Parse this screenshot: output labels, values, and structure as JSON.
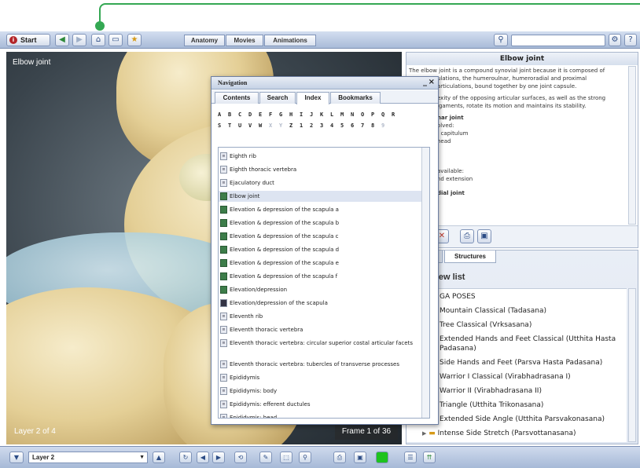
{
  "toolbar": {
    "start_label": "Start",
    "tabs": [
      "Anatomy",
      "Movies",
      "Animations"
    ],
    "search_value": ""
  },
  "viewer": {
    "title": "Elbow joint",
    "layer_label": "Layer 2 of 4",
    "frame_counter": "Frame 1 of 36"
  },
  "info_panel": {
    "title": "Elbow joint",
    "paragraphs": [
      "The elbow joint is a compound synovial joint because it is composed of",
      "ulations, the humeroulnar, humeroradial and proximal",
      "articulations, bound together by one joint capsule."
    ],
    "paragraph2": [
      "exity of the opposing articular surfaces, as well as the strong",
      "igaments, rotate its motion and maintains its stability."
    ],
    "section1": {
      "heading": "nar joint",
      "lines": [
        "olved:",
        ": capitulum",
        "head"
      ]
    },
    "section2": {
      "lines": [
        "available:",
        "nd extension"
      ]
    },
    "section3": {
      "heading": "dial joint"
    }
  },
  "lower_panel": {
    "sections_tab": "s",
    "structures_tab": "Structures",
    "list_title": "omy view list",
    "items": [
      "GA POSES",
      "Mountain Classical (Tadasana)",
      "Tree Classical (Vrksasana)",
      "Extended Hands and Feet Classical (Utthita Hasta",
      "Padasana)",
      "Side Hands and Feet (Parsva Hasta Padasana)",
      "Warrior I Classical (Virabhadrasana I)",
      "Warrior II (Virabhadrasana II)",
      "Triangle (Utthita Trikonasana)",
      "Extended Side Angle (Utthita Parsvakonasana)",
      "Intense Side Stretch (Parsvottanasana)"
    ]
  },
  "navigation": {
    "title": "Navigation",
    "min_label": "_",
    "close_label": "×",
    "tabs": [
      "Contents",
      "Search",
      "Index",
      "Bookmarks"
    ],
    "active_tab": "Index",
    "letters_row1": [
      "A",
      "B",
      "C",
      "D",
      "E",
      "F",
      "G",
      "H",
      "I",
      "J",
      "K",
      "L",
      "M",
      "N",
      "O",
      "P",
      "Q",
      "R"
    ],
    "letters_row2": [
      "S",
      "T",
      "U",
      "V",
      "W",
      "X",
      "Y",
      "Z",
      "1",
      "2",
      "3",
      "4",
      "5",
      "6",
      "7",
      "8",
      "9"
    ],
    "index_items": [
      {
        "label": "Eighth rib",
        "icon": "page-icon"
      },
      {
        "label": "Eighth thoracic vertebra",
        "icon": "page-icon"
      },
      {
        "label": "Ejaculatory duct",
        "icon": "page-icon"
      },
      {
        "label": "Elbow joint",
        "icon": "animation-icon",
        "selected": true
      },
      {
        "label": "Elevation & depression of the scapula a",
        "icon": "animation-icon"
      },
      {
        "label": "Elevation & depression of the scapula b",
        "icon": "animation-icon"
      },
      {
        "label": "Elevation & depression of the scapula c",
        "icon": "animation-icon"
      },
      {
        "label": "Elevation & depression of the scapula d",
        "icon": "animation-icon"
      },
      {
        "label": "Elevation & depression of the scapula e",
        "icon": "animation-icon"
      },
      {
        "label": "Elevation & depression of the scapula f",
        "icon": "animation-icon"
      },
      {
        "label": "Elevation/depression",
        "icon": "animation-icon"
      },
      {
        "label": "Elevation/depression of the scapula",
        "icon": "movie-icon"
      },
      {
        "label": "Eleventh rib",
        "icon": "page-icon"
      },
      {
        "label": "Eleventh thoracic vertebra",
        "icon": "page-icon"
      },
      {
        "label": "Eleventh thoracic vertebra: circular superior costal articular facets",
        "icon": "page-icon"
      },
      {
        "label": "Eleventh thoracic vertebra: tubercles of transverse processes",
        "icon": "page-icon"
      },
      {
        "label": "Epididymis",
        "icon": "page-icon"
      },
      {
        "label": "Epididymis: body",
        "icon": "page-icon"
      },
      {
        "label": "Epididymis: efferent ductules",
        "icon": "page-icon"
      },
      {
        "label": "Epididymis: head",
        "icon": "page-icon"
      }
    ]
  },
  "bottom_toolbar": {
    "layer_value": "Layer 2"
  },
  "colors": {
    "callout": "#34a853",
    "toolbar": "#a9bbd8",
    "selected_row": "#dde4f1"
  }
}
